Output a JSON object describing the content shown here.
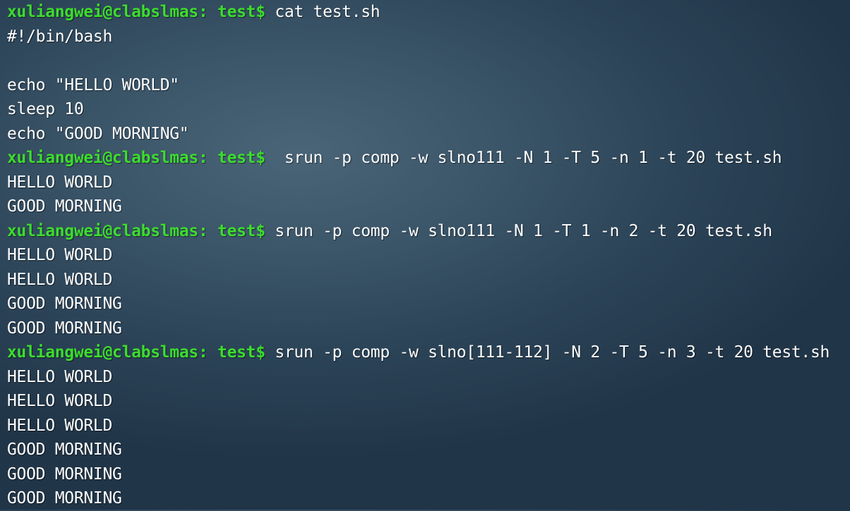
{
  "terminal": {
    "prompt": "xuliangwei@clabslmas: test$",
    "lines": [
      {
        "type": "cmd",
        "prompt": "xuliangwei@clabslmas: test$",
        "text": " cat test.sh"
      },
      {
        "type": "out",
        "text": "#!/bin/bash"
      },
      {
        "type": "out",
        "text": ""
      },
      {
        "type": "out",
        "text": "echo \"HELLO WORLD\""
      },
      {
        "type": "out",
        "text": "sleep 10"
      },
      {
        "type": "out",
        "text": "echo \"GOOD MORNING\""
      },
      {
        "type": "cmd",
        "prompt": "xuliangwei@clabslmas: test$",
        "text": "  srun -p comp -w slno111 -N 1 -T 5 -n 1 -t 20 test.sh"
      },
      {
        "type": "out",
        "text": "HELLO WORLD"
      },
      {
        "type": "out",
        "text": "GOOD MORNING"
      },
      {
        "type": "cmd",
        "prompt": "xuliangwei@clabslmas: test$",
        "text": " srun -p comp -w slno111 -N 1 -T 1 -n 2 -t 20 test.sh"
      },
      {
        "type": "out",
        "text": "HELLO WORLD"
      },
      {
        "type": "out",
        "text": "HELLO WORLD"
      },
      {
        "type": "out",
        "text": "GOOD MORNING"
      },
      {
        "type": "out",
        "text": "GOOD MORNING"
      },
      {
        "type": "cmd",
        "prompt": "xuliangwei@clabslmas: test$",
        "text": " srun -p comp -w slno[111-112] -N 2 -T 5 -n 3 -t 20 test.sh"
      },
      {
        "type": "out",
        "text": "HELLO WORLD"
      },
      {
        "type": "out",
        "text": "HELLO WORLD"
      },
      {
        "type": "out",
        "text": "HELLO WORLD"
      },
      {
        "type": "out",
        "text": "GOOD MORNING"
      },
      {
        "type": "out",
        "text": "GOOD MORNING"
      },
      {
        "type": "out",
        "text": "GOOD MORNING"
      }
    ]
  },
  "colors": {
    "prompt": "#3ddc2e",
    "text": "#ffffff",
    "background": "#2c4458"
  }
}
